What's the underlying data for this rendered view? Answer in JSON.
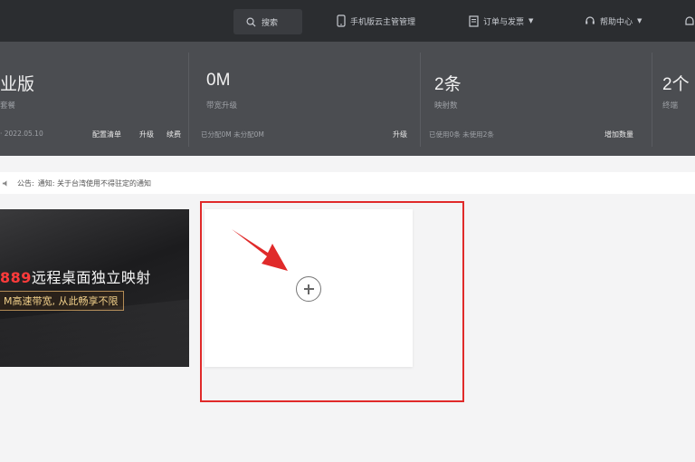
{
  "topbar": {
    "search_label": "搜索",
    "items": [
      {
        "label": "手机版云主管管理",
        "icon": "phone-icon"
      },
      {
        "label": "订单与发票",
        "icon": "document-icon"
      },
      {
        "label": "帮助中心",
        "icon": "headset-icon"
      }
    ]
  },
  "stats": [
    {
      "value": "业版",
      "sub": "套餐",
      "foot": "· 2022.05.10",
      "links": [
        "配置清单",
        "升级",
        "续费"
      ]
    },
    {
      "value": "0M",
      "sub": "带宽升级",
      "foot": "已分配0M  未分配0M",
      "links": [
        "升级"
      ]
    },
    {
      "value": "2条",
      "sub": "映射数",
      "foot": "已使用0条  未使用2条",
      "links": [
        "增加数量"
      ]
    },
    {
      "value": "2个",
      "sub": "终端"
    }
  ],
  "notice": {
    "label": "公告:",
    "text": "通知: 关于台湾使用不得驻定的通知"
  },
  "banner": {
    "title_highlight": "889",
    "title_rest": "远程桌面独立映射",
    "tag": "M高速带宽, 从此畅享不限"
  },
  "colors": {
    "topbar": "#2b2d30",
    "stats_band": "#4b4d51",
    "highlight": "#e02a2a"
  }
}
